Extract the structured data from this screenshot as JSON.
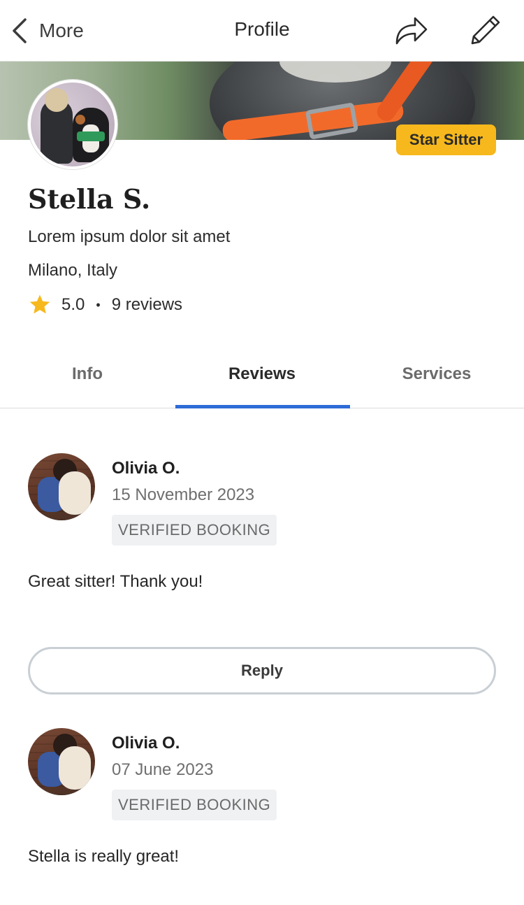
{
  "header": {
    "back_label": "More",
    "title": "Profile"
  },
  "profile": {
    "badge": "Star Sitter",
    "name": "Stella S.",
    "tagline": "Lorem ipsum dolor sit amet",
    "location": "Milano, Italy",
    "rating": "5.0",
    "separator": "•",
    "reviews_count": "9 reviews"
  },
  "tabs": [
    {
      "label": "Info",
      "active": false
    },
    {
      "label": "Reviews",
      "active": true
    },
    {
      "label": "Services",
      "active": false
    }
  ],
  "reviews": [
    {
      "author": "Olivia O.",
      "date": "15 November 2023",
      "tag": "VERIFIED BOOKING",
      "text": "Great sitter! Thank you!",
      "reply_label": "Reply"
    },
    {
      "author": "Olivia O.",
      "date": "07 June 2023",
      "tag": "VERIFIED BOOKING",
      "text": "Stella is really great!"
    }
  ],
  "colors": {
    "accent_tab": "#2e6bd6",
    "badge": "#f6b81c",
    "star": "#f6b81c"
  },
  "icons": [
    "chevron-left-icon",
    "share-icon",
    "pencil-icon",
    "star-icon"
  ]
}
